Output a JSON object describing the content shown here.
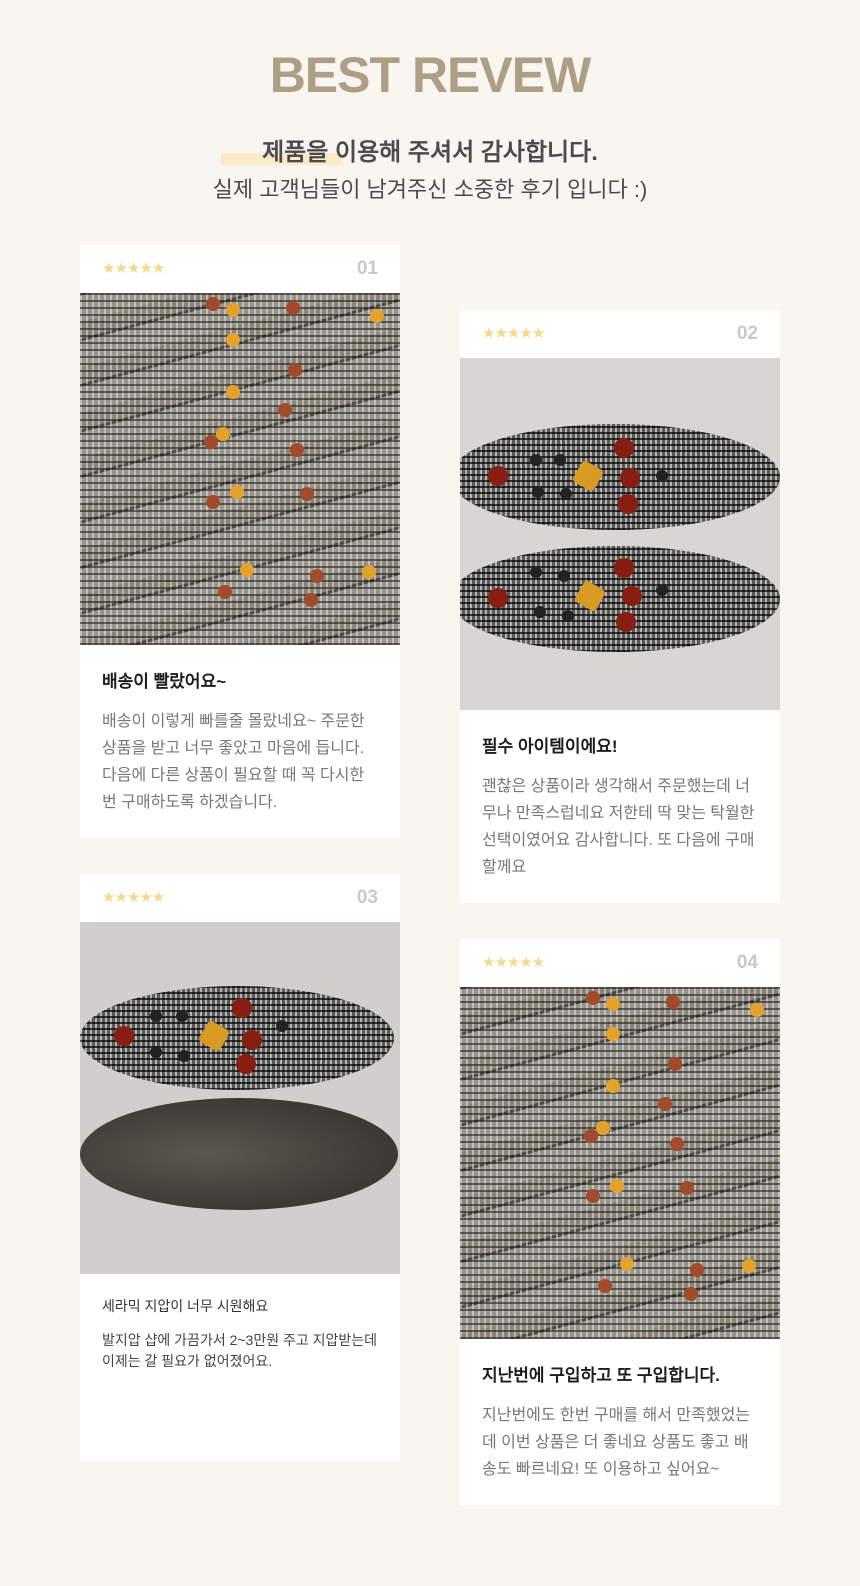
{
  "header": {
    "title": "BEST REVEW",
    "subtitle": "제품을 이용해 주셔서 감사합니다.",
    "description": "실제 고객님들이 남겨주신 소중한 후기 입니다 :)"
  },
  "colors": {
    "title": "#ac9f85",
    "star": "#f4d98c",
    "background": "#f9f6f1",
    "card": "#ffffff"
  },
  "reviews": [
    {
      "rating_stars": "★★★★★",
      "rating": 5,
      "number": "01",
      "photo": "insoles-pile-photo",
      "title": "배송이 빨랐어요~",
      "text": "배송이 이렇게 빠를줄 몰랐네요~ 주문한 상품을 받고 너무 좋았고 마음에 듭니다. 다음에 다른 상품이 필요할 때 꼭 다시한번 구매하도록 하겠습니다."
    },
    {
      "rating_stars": "★★★★★",
      "rating": 5,
      "number": "02",
      "photo": "two-insoles-photo",
      "title": "필수 아이템이에요!",
      "text": "괜찮은 상품이라 생각해서 주문했는데 너무나 만족스럽네요 저한테 딱 맞는 탁월한 선택이였어요 감사합니다. 또 다음에 구매할께요"
    },
    {
      "rating_stars": "★★★★★",
      "rating": 5,
      "number": "03",
      "photo": "insole-front-back-photo",
      "title": "세라믹 지압이 너무 시원해요",
      "text": "발지압 샵에 가끔가서 2~3만원 주고 지압받는데 이제는 갈 필요가 없어졌어요."
    },
    {
      "rating_stars": "★★★★★",
      "rating": 5,
      "number": "04",
      "photo": "insoles-pile-photo",
      "title": "지난번에 구입하고 또 구입합니다.",
      "text": "지난번에도 한번 구매를 해서 만족했었는데 이번 상품은 더 좋네요 상품도 좋고 배송도 빠르네요! 또 이용하고 싶어요~"
    }
  ]
}
